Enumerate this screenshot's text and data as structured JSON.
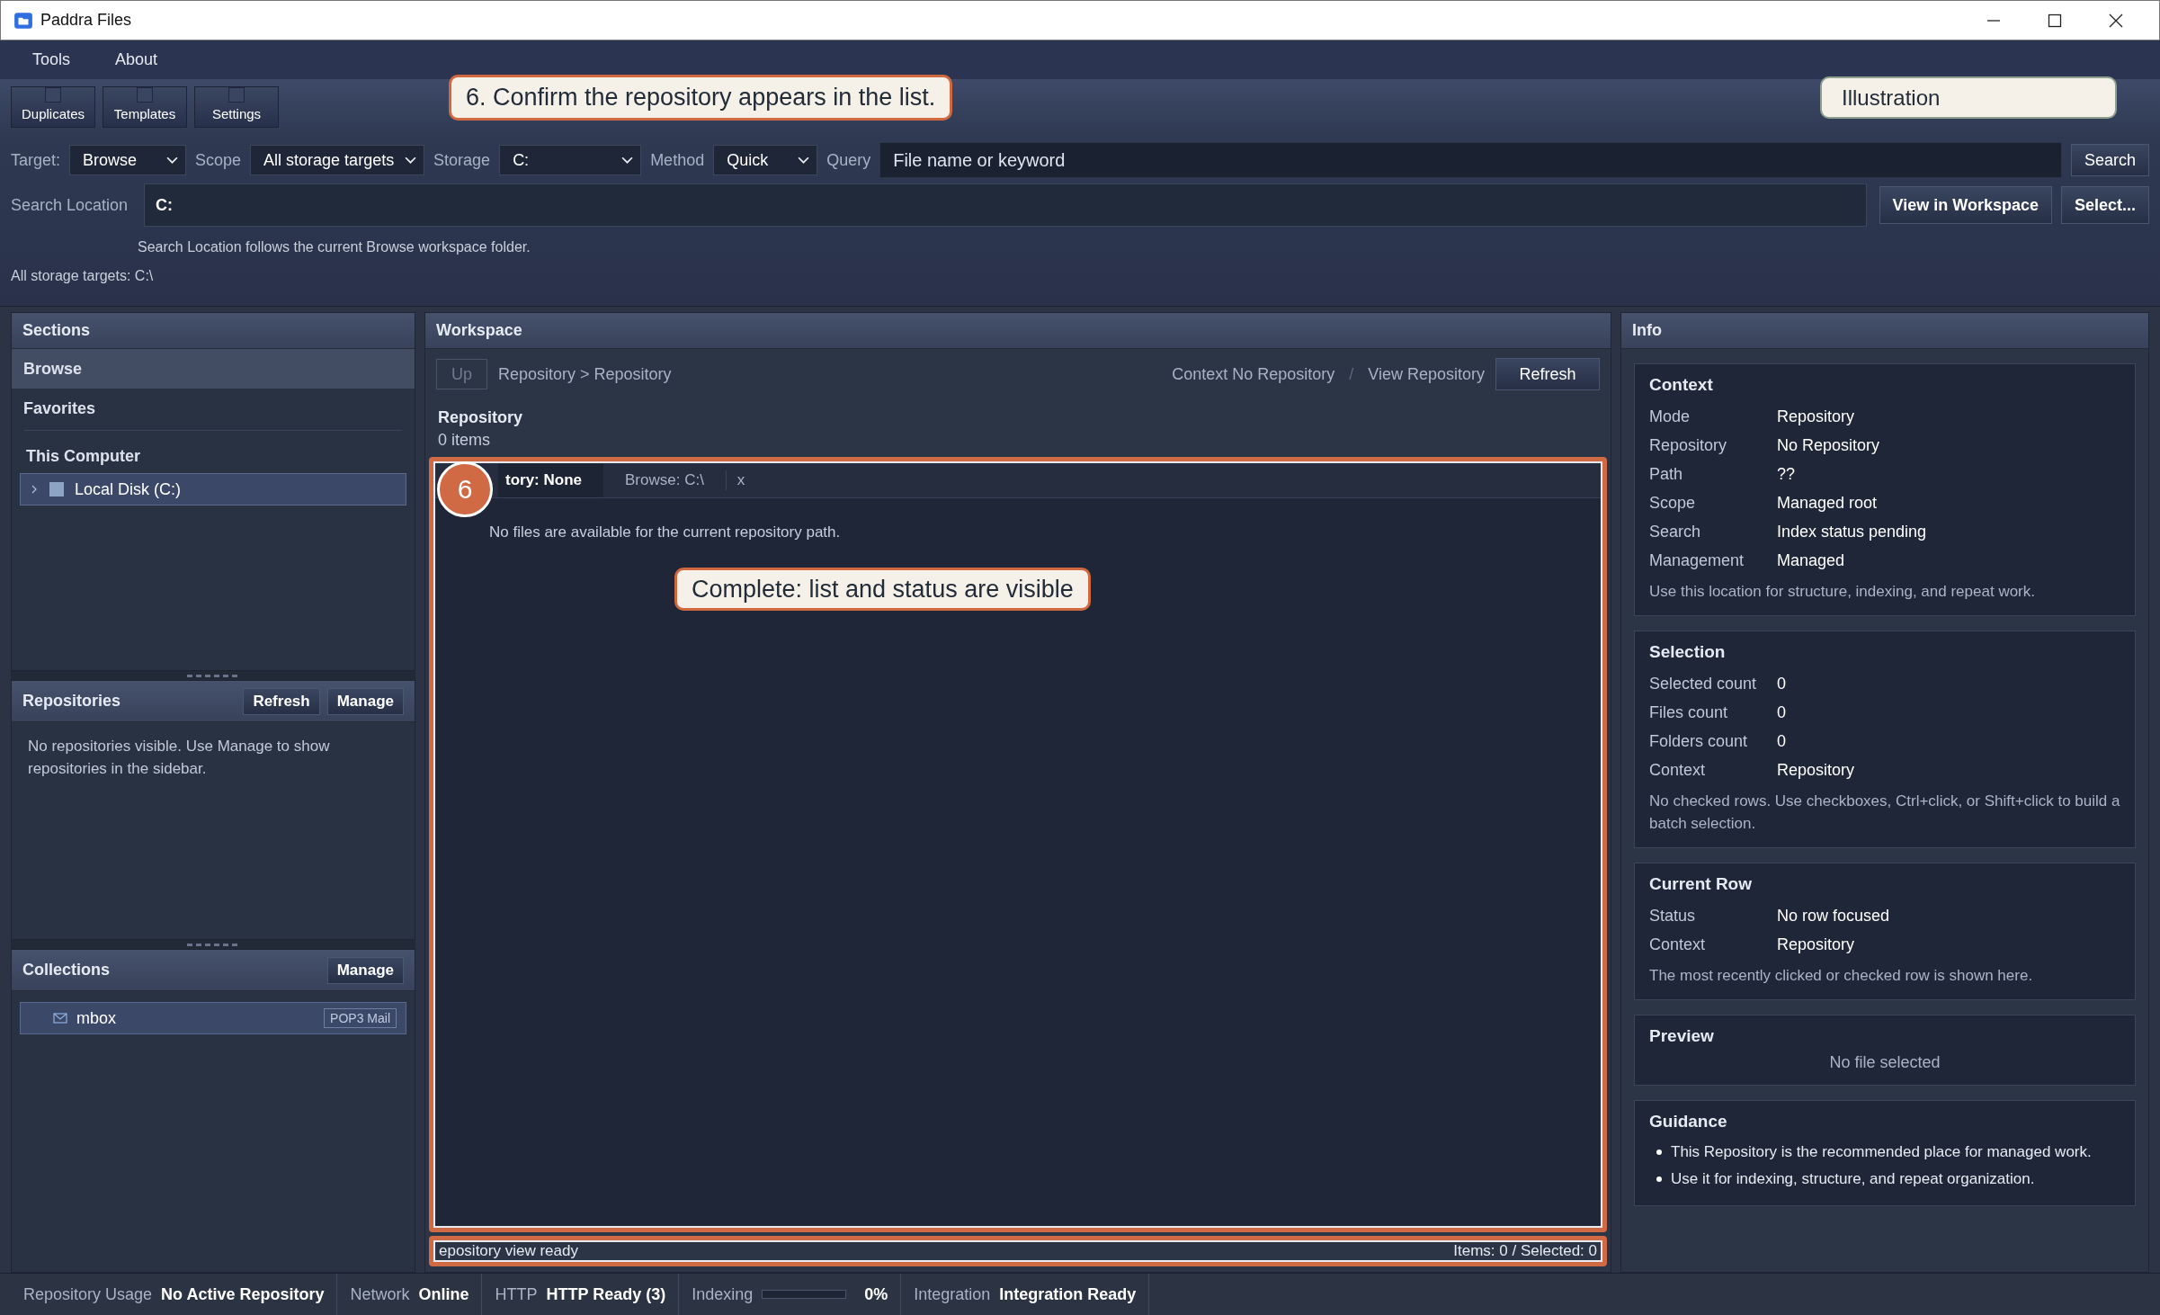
{
  "window": {
    "title": "Paddra Files"
  },
  "menu": [
    "Tools",
    "About"
  ],
  "toolbar": [
    {
      "label": "Duplicates"
    },
    {
      "label": "Templates"
    },
    {
      "label": "Settings"
    }
  ],
  "annotations": {
    "step": "6. Confirm the repository appears in the list.",
    "illustration": "Illustration",
    "marker": "6",
    "result": "Complete: list and status are visible"
  },
  "filters": [
    {
      "label": "Target:",
      "value": "Browse"
    },
    {
      "label": "Scope",
      "value": "All storage targets"
    },
    {
      "label": "Storage",
      "value": "C:"
    },
    {
      "label": "Method",
      "value": "Quick"
    }
  ],
  "query": {
    "label": "Query",
    "placeholder": "File name or keyword",
    "button": "Search"
  },
  "search_location": {
    "label": "Search Location",
    "value": "C:",
    "buttons": [
      "View in Workspace",
      "Select..."
    ],
    "hint": "Search Location follows the current Browse workspace folder.",
    "scope_note": "All storage targets: C:\\"
  },
  "sections": {
    "title": "Sections",
    "items": [
      {
        "label": "Browse",
        "selected": true
      },
      {
        "label": "Favorites",
        "selected": false
      }
    ],
    "group": "This Computer",
    "tree": [
      {
        "label": "Local Disk (C:)",
        "expanded": false,
        "selected": true
      }
    ]
  },
  "repositories": {
    "title": "Repositories",
    "buttons": [
      "Refresh",
      "Manage"
    ],
    "message": "No repositories visible. Use Manage to show repositories in the sidebar."
  },
  "collections": {
    "title": "Collections",
    "buttons": [
      "Manage"
    ],
    "items": [
      {
        "label": "mbox",
        "tag": "POP3 Mail",
        "selected": true
      }
    ]
  },
  "workspace": {
    "title": "Workspace",
    "up": {
      "label": "Up",
      "disabled": true
    },
    "breadcrumb": "Repository > Repository",
    "context": "Context No Repository",
    "separator": "/",
    "view": "View Repository",
    "refresh": "Refresh",
    "heading": "Repository",
    "count": "0 items",
    "tabs": [
      {
        "label": "tory: None",
        "selected": true
      },
      {
        "label": "Browse: C:\\",
        "selected": false
      },
      {
        "label": "x",
        "selected": false
      }
    ],
    "empty": "No files are available for the current repository path.",
    "status": "epository view ready",
    "totals": "Items: 0 / Selected: 0"
  },
  "info": {
    "title": "Info",
    "cards": [
      {
        "title": "Context",
        "rows": [
          {
            "label": "Mode",
            "value": "Repository"
          },
          {
            "label": "Repository",
            "value": "No Repository"
          },
          {
            "label": "Path",
            "value": "??"
          },
          {
            "label": "Scope",
            "value": "Managed root"
          },
          {
            "label": "Search",
            "value": "Index status pending"
          },
          {
            "label": "Management",
            "value": "Managed"
          }
        ],
        "note": "Use this location for structure, indexing, and repeat work."
      },
      {
        "title": "Selection",
        "rows": [
          {
            "label": "Selected count",
            "value": "0"
          },
          {
            "label": "Files count",
            "value": "0"
          },
          {
            "label": "Folders count",
            "value": "0"
          },
          {
            "label": "Context",
            "value": "Repository"
          }
        ],
        "note": "No checked rows. Use checkboxes, Ctrl+click, or Shift+click to build a batch selection."
      },
      {
        "title": "Current Row",
        "rows": [
          {
            "label": "Status",
            "value": "No row focused"
          },
          {
            "label": "Context",
            "value": "Repository"
          }
        ],
        "note": "The most recently clicked or checked row is shown here."
      },
      {
        "title": "Preview",
        "message": "No file selected"
      },
      {
        "title": "Guidance",
        "bullets": [
          "This Repository is the recommended place for managed work.",
          "Use it for indexing, structure, and repeat organization."
        ]
      }
    ]
  },
  "status_bar": [
    {
      "kind": "text",
      "label": "Repository Usage",
      "value": "No Active Repository"
    },
    {
      "kind": "text",
      "label": "Network",
      "value": "Online"
    },
    {
      "kind": "text",
      "label": "HTTP",
      "value": "HTTP Ready (3)"
    },
    {
      "kind": "progress",
      "label": "Indexing",
      "level": 0,
      "value": "0%"
    },
    {
      "kind": "text",
      "label": "Integration",
      "value": "Integration Ready"
    }
  ]
}
